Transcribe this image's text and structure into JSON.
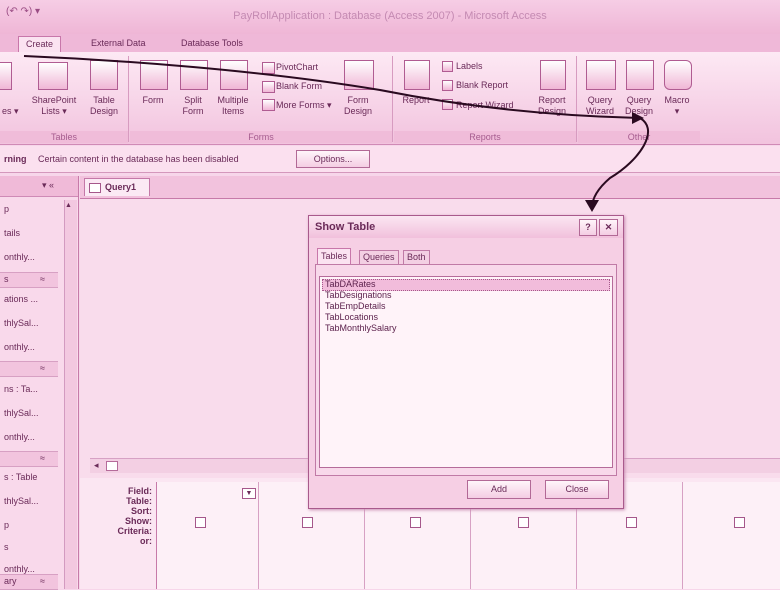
{
  "titlebar": {
    "qat": "(↶ ↷) ▾",
    "title": "PayRollApplication : Database (Access 2007) - Microsoft Access"
  },
  "ribbon_tabs": [
    "Create",
    "External Data",
    "Database Tools"
  ],
  "ribbon": {
    "tables": {
      "sharepoint": "SharePoint",
      "sharepoint2": "Lists ▾",
      "table": "Table",
      "table2": "Design",
      "left_clip": "es ▾",
      "group": "Tables"
    },
    "forms": {
      "form": "Form",
      "split": "Split",
      "split2": "Form",
      "multiple": "Multiple",
      "multiple2": "Items",
      "pivot": "PivotChart",
      "blank": "Blank Form",
      "more": "More Forms ▾",
      "design": "Form",
      "design2": "Design",
      "group": "Forms"
    },
    "reports": {
      "report": "Report",
      "labels": "Labels",
      "blank": "Blank Report",
      "wizard": "Report Wizard",
      "design": "Report",
      "design2": "Design",
      "group": "Reports"
    },
    "other": {
      "qwizard": "Query",
      "qwizard2": "Wizard",
      "qdesign": "Query",
      "qdesign2": "Design",
      "macro": "Macro",
      "macro2": "▾",
      "group": "Other"
    }
  },
  "message_bar": {
    "prefix": "rning",
    "text": "Certain content in the database has been disabled",
    "options": "Options..."
  },
  "nav_pane": {
    "header_arrows": "▾  «",
    "items": [
      "p",
      "tails",
      "onthly...",
      "ations ...",
      "thlySal...",
      "onthly...",
      "ns : Ta...",
      "thlySal...",
      "onthly...",
      "s : Table",
      "thlySal...",
      "p",
      "s",
      "onthly..."
    ],
    "groups": [
      "s",
      "",
      "",
      "",
      "ary"
    ]
  },
  "doc_tab": "Query1",
  "design_grid": {
    "rows": [
      "Field:",
      "Table:",
      "Sort:",
      "Show:",
      "Criteria:",
      "or:"
    ]
  },
  "show_table": {
    "title": "Show Table",
    "help": "?",
    "close_x": "✕",
    "tabs": [
      "Tables",
      "Queries",
      "Both"
    ],
    "items": [
      "TabDARates",
      "TabDesignations",
      "TabEmpDetails",
      "TabLocations",
      "TabMonthlySalary"
    ],
    "add": "Add",
    "close": "Close"
  }
}
